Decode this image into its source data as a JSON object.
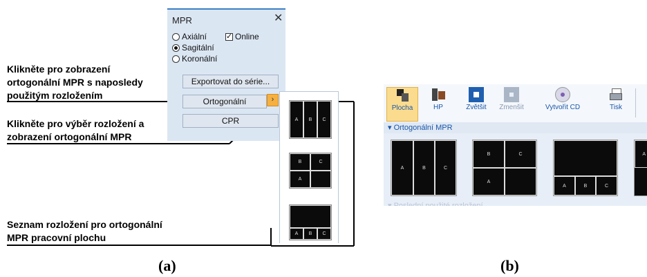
{
  "callouts": {
    "c1": [
      "Klikněte pro zobrazení",
      "ortogonální MPR s naposledy",
      "použitým rozložením"
    ],
    "c2": [
      "Klikněte pro výběr rozložení a",
      "zobrazení ortogonální MPR"
    ],
    "c3": [
      "Seznam rozložení pro ortogonální",
      "MPR pracovní plochu"
    ]
  },
  "mpr_panel": {
    "title": "MPR",
    "close_glyph": "✕",
    "radio_axial": "Axiální",
    "radio_sagittal": "Sagitální",
    "radio_coronal": "Koronální",
    "online_label": "Online",
    "online_checked": true,
    "selected_radio": "Sagitální",
    "export_button": "Exportovat do série...",
    "ortho_button": "Ortogonální",
    "ortho_arrow": "›",
    "cpr_button": "CPR"
  },
  "dropdown_layouts": [
    {
      "cells": [
        "A",
        "B",
        "C"
      ]
    },
    {
      "cells": [
        "B",
        "C",
        "A",
        ""
      ]
    },
    {
      "cells": [
        "",
        "A",
        "B",
        "C"
      ]
    }
  ],
  "ribbon": {
    "buttons": [
      "Plocha",
      "HP",
      "Zvětšit",
      "Zmenšit",
      "Vytvořit CD",
      "Tisk"
    ],
    "active_button": "Plocha",
    "group_title": "▾ Ortogonální MPR",
    "faded_group": "▾ Poslední použité rozložení",
    "accent": "#1a56a8",
    "active_color": "#fbdc8e"
  },
  "ribbon_layouts": [
    {
      "cells": [
        "A",
        "B",
        "C"
      ]
    },
    {
      "cells": [
        "B",
        "C",
        "A",
        ""
      ]
    },
    {
      "cells": [
        "",
        "A",
        "B",
        "C"
      ]
    },
    {
      "cells": [
        "A"
      ]
    }
  ],
  "captions": {
    "a": "(a)",
    "b": "(b)"
  }
}
